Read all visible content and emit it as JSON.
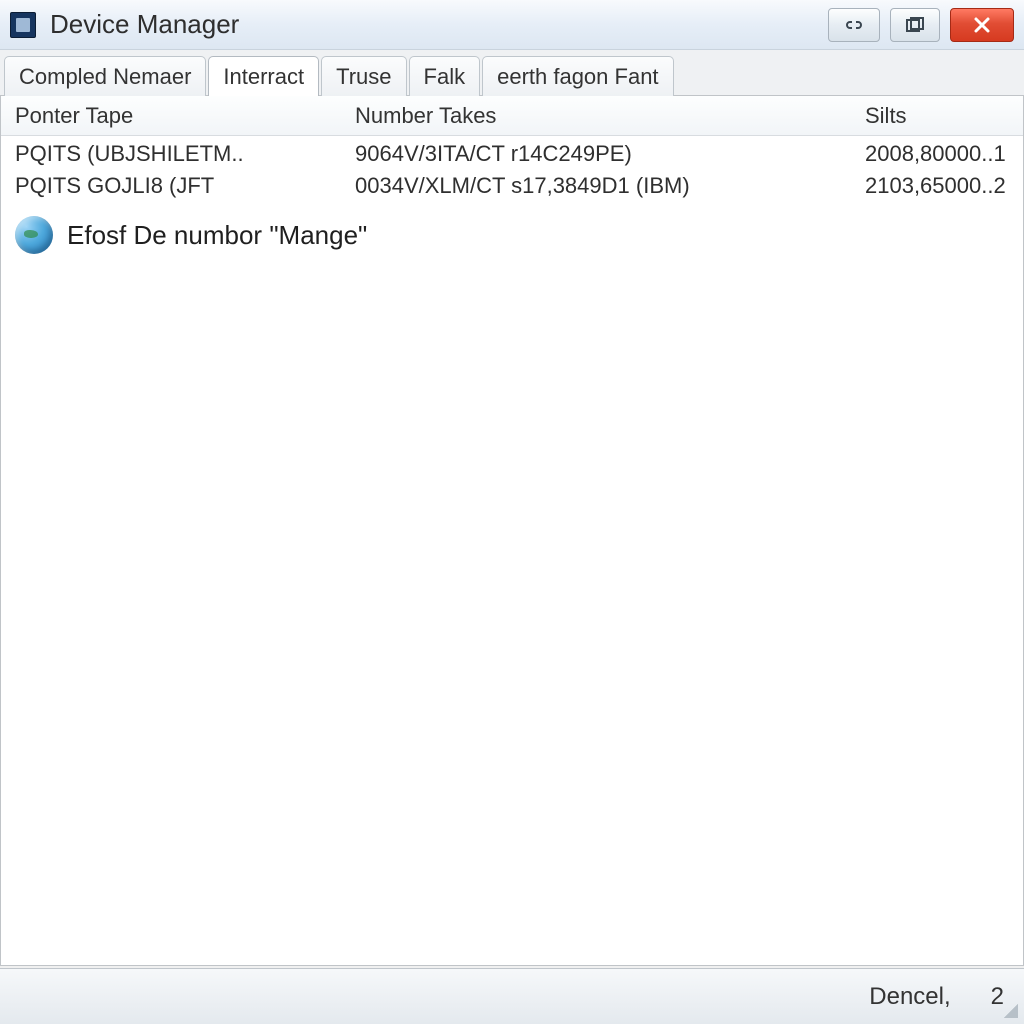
{
  "window": {
    "title": "Device Manager"
  },
  "caption_buttons": {
    "minimize_glyph": "�календ",
    "maximize_glyph": "❐",
    "close_glyph": "✕"
  },
  "tabs": [
    {
      "label": "Compled Nemaer",
      "active": false
    },
    {
      "label": "Interract",
      "active": true
    },
    {
      "label": "Truse",
      "active": false
    },
    {
      "label": "Falk",
      "active": false
    },
    {
      "label": "eerth fagon Fant",
      "active": false
    }
  ],
  "columns": {
    "c1": "Ponter Tape",
    "c2": "Number Takes",
    "c3": "Silts"
  },
  "rows": [
    {
      "c1": "PQITS (UBJSHILETM..",
      "c2": "9064V/3ITA/CT r14C249PE)",
      "c3": "2008,80000..1"
    },
    {
      "c1": "PQITS GOJLI8 (JFT",
      "c2": "0034V/XLM/CT s17,3849D1 (IBM)",
      "c3": "2103,65000..2"
    }
  ],
  "info_line": "Efosf De numbor \"Mange\"",
  "statusbar": {
    "left": "Dencel,",
    "right": "2"
  }
}
